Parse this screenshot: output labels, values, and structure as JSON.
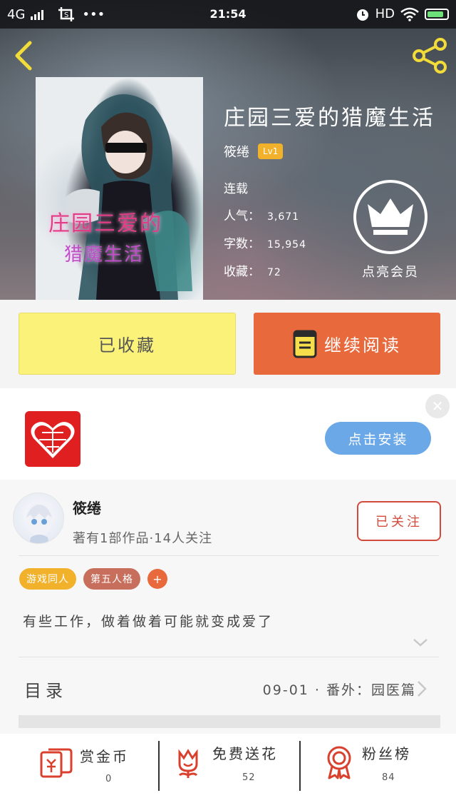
{
  "statusbar": {
    "network": "4G",
    "time": "21:54",
    "hd": "HD",
    "dots": "•••"
  },
  "book": {
    "title": "庄园三爱的猎魔生活",
    "author": "筱绻",
    "author_level": "Lv1",
    "status": "连载",
    "popularity_label": "人气：",
    "popularity": "3,671",
    "words_label": "字数：",
    "words": "15,954",
    "favorites_label": "收藏：",
    "favorites": "72",
    "cover_text_line1": "庄园三爱的",
    "cover_text_line2": "猎魔生活"
  },
  "vip": {
    "label": "点亮会员"
  },
  "actions": {
    "favorite_label": "已收藏",
    "read_label": "继续阅读"
  },
  "ad": {
    "install_label": "点击安装",
    "close_icon": "✕"
  },
  "author_card": {
    "name": "筱绻",
    "stats": "著有1部作品·14人关注",
    "follow_label": "已关注",
    "tags": [
      {
        "label": "游戏同人",
        "color": "#f2b12b"
      },
      {
        "label": "第五人格",
        "color": "#c86e5c"
      }
    ],
    "tag_add": "+",
    "intro": "有些工作，做着做着可能就变成爱了"
  },
  "toc": {
    "label": "目录",
    "latest": "09-01 · 番外：园医篇"
  },
  "bottom_bar": [
    {
      "label": "赏金币",
      "value": "0",
      "icon": "red-envelope-icon"
    },
    {
      "label": "免费送花",
      "value": "52",
      "icon": "flower-icon"
    },
    {
      "label": "粉丝榜",
      "value": "84",
      "icon": "award-ribbon-icon"
    }
  ],
  "colors": {
    "accent_orange": "#e8693c",
    "fav_yellow": "#fbf27a",
    "follow_red": "#d44a3a",
    "install_blue": "#6ba8e8",
    "icon_red": "#d9402e"
  }
}
